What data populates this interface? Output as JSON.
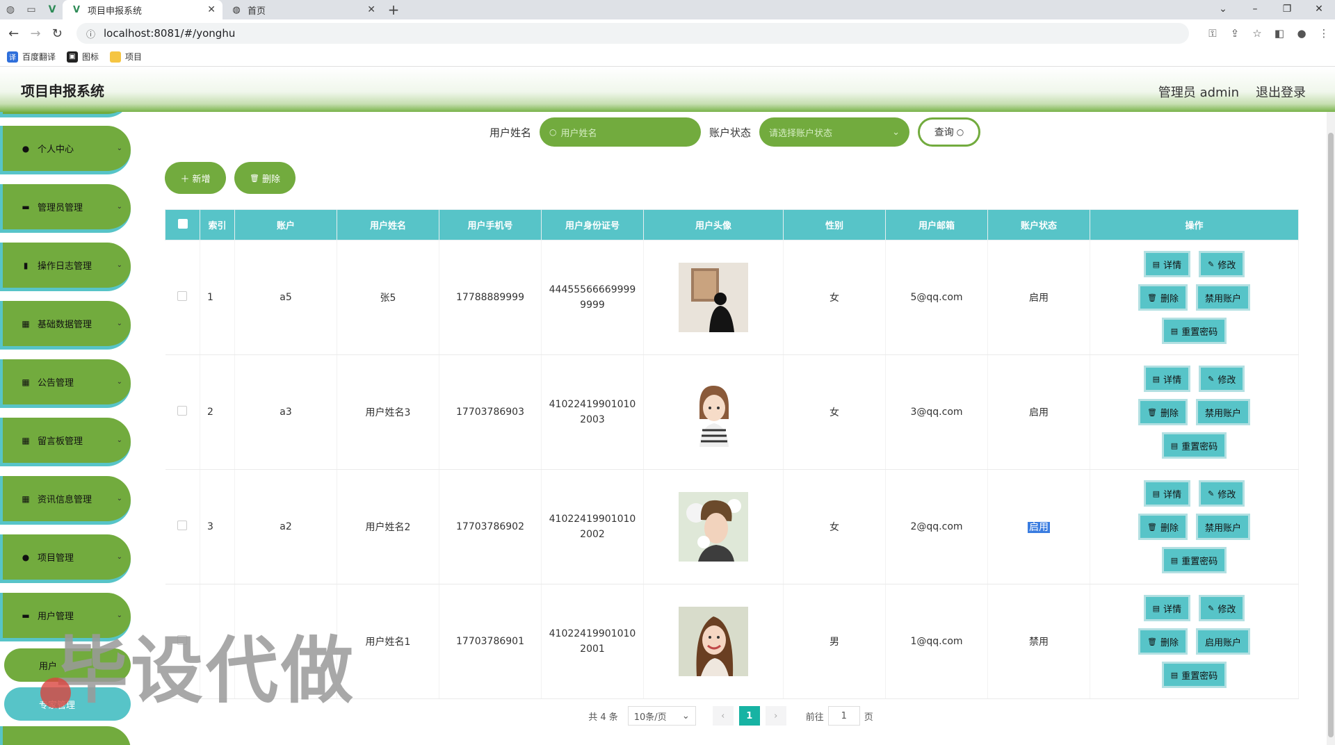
{
  "browser": {
    "tabs": [
      {
        "title": "项目申报系统",
        "active": true
      },
      {
        "title": "首页",
        "active": false
      }
    ],
    "url": "localhost:8081/#/yonghu",
    "bookmarks": [
      "百度翻译",
      "图标",
      "项目"
    ]
  },
  "header": {
    "title": "项目申报系统",
    "user": "管理员 admin",
    "logout": "退出登录"
  },
  "sidebar": {
    "items": [
      {
        "label": "个人中心",
        "icon": "user-icon"
      },
      {
        "label": "管理员管理",
        "icon": "monitor-icon"
      },
      {
        "label": "操作日志管理",
        "icon": "clipboard-icon"
      },
      {
        "label": "基础数据管理",
        "icon": "grid-icon"
      },
      {
        "label": "公告管理",
        "icon": "grid-icon"
      },
      {
        "label": "留言板管理",
        "icon": "grid-icon"
      },
      {
        "label": "资讯信息管理",
        "icon": "grid-icon"
      },
      {
        "label": "项目管理",
        "icon": "user-icon"
      },
      {
        "label": "用户管理",
        "icon": "monitor-icon"
      }
    ],
    "subitems": [
      "用户",
      "专家管理"
    ]
  },
  "search": {
    "name_label": "用户姓名",
    "name_placeholder": "用户姓名",
    "status_label": "账户状态",
    "status_placeholder": "请选择账户状态",
    "query_button": "查询"
  },
  "actions": {
    "add": "新增",
    "delete": "删除"
  },
  "table": {
    "columns": [
      "索引",
      "账户",
      "用户姓名",
      "用户手机号",
      "用户身份证号",
      "用户头像",
      "性别",
      "用户邮箱",
      "账户状态",
      "操作"
    ],
    "rows": [
      {
        "index": "1",
        "account": "a5",
        "name": "张5",
        "phone": "17788889999",
        "idcard": "444555666699999999",
        "gender": "女",
        "email": "5@qq.com",
        "status": "启用",
        "toggle": "禁用账户",
        "avatar": "art-gallery-photo"
      },
      {
        "index": "2",
        "account": "a3",
        "name": "用户姓名3",
        "phone": "17703786903",
        "idcard": "410224199010102003",
        "gender": "女",
        "email": "3@qq.com",
        "status": "启用",
        "toggle": "禁用账户",
        "avatar": "cartoon-girl"
      },
      {
        "index": "3",
        "account": "a2",
        "name": "用户姓名2",
        "phone": "17703786902",
        "idcard": "410224199010102002",
        "gender": "女",
        "email": "2@qq.com",
        "status": "启用",
        "toggle": "禁用账户",
        "avatar": "flower-portrait"
      },
      {
        "index": "",
        "account": "",
        "name": "用户姓名1",
        "phone": "17703786901",
        "idcard": "410224199010102001",
        "gender": "男",
        "email": "1@qq.com",
        "status": "禁用",
        "toggle": "启用账户",
        "avatar": "smiling-woman"
      }
    ],
    "op_labels": {
      "detail": "详情",
      "edit": "修改",
      "delete": "删除",
      "reset": "重置密码"
    }
  },
  "pagination": {
    "total": "共 4 条",
    "page_size": "10条/页",
    "current": "1",
    "goto_label": "前往",
    "goto_value": "1",
    "page_suffix": "页"
  },
  "watermark": "毕设代做",
  "colors": {
    "green": "#72ab3e",
    "teal": "#57c4c8",
    "page_active": "#17b3a3"
  }
}
